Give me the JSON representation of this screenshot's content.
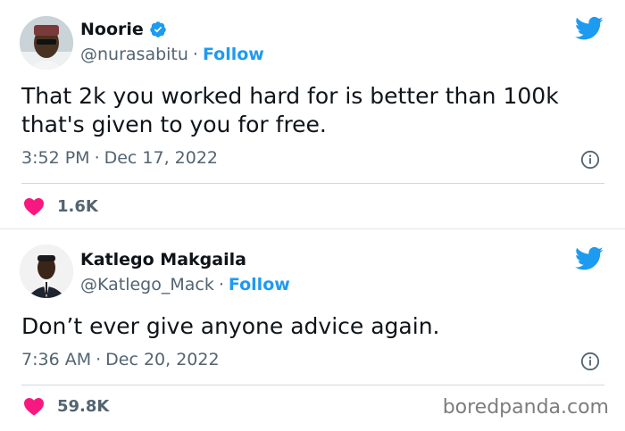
{
  "colors": {
    "link": "#1d9bf0",
    "heart": "#f91880",
    "muted": "#536471",
    "text": "#0f1419"
  },
  "tweets": [
    {
      "display_name": "Noorie",
      "verified": true,
      "handle": "@nurasabitu",
      "separator": "·",
      "follow_label": "Follow",
      "text": "That 2k you worked hard for is better than 100k that's given to you for free.",
      "time": "3:52 PM",
      "date": "Dec 17, 2022",
      "likes": "1.6K",
      "icons": [
        "twitter-bird-icon",
        "info-icon",
        "heart-icon",
        "verified-badge-icon"
      ]
    },
    {
      "display_name": "Katlego Makgaila",
      "verified": false,
      "handle": "@Katlego_Mack",
      "separator": "·",
      "follow_label": "Follow",
      "text": "Don’t ever give anyone advice again.",
      "time": "7:36 AM",
      "date": "Dec 20, 2022",
      "likes": "59.8K",
      "icons": [
        "twitter-bird-icon",
        "info-icon",
        "heart-icon"
      ]
    }
  ],
  "watermark": "boredpanda.com"
}
